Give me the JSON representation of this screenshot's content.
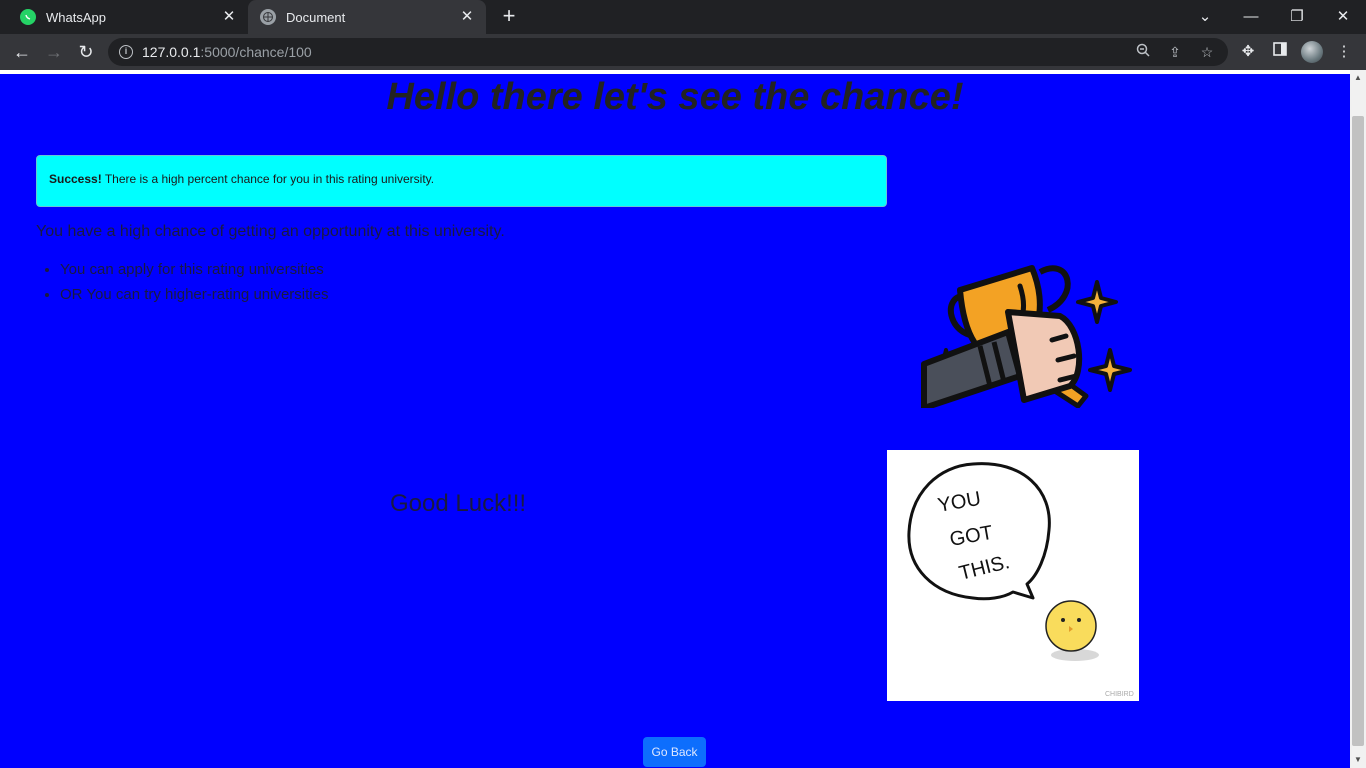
{
  "browser": {
    "tabs": [
      {
        "title": "WhatsApp",
        "icon": "whatsapp-icon",
        "active": false
      },
      {
        "title": "Document",
        "icon": "globe-icon",
        "active": true
      }
    ],
    "url_host": "127.0.0.1",
    "url_path": ":5000/chance/100",
    "accent": "#202124"
  },
  "page": {
    "background": "#0000ff",
    "heading": "Hello there let's see the chance!",
    "alert": {
      "strong": "Success!",
      "text": " There is a high percent chance for you in this rating university."
    },
    "lead": "You have a high chance of getting an opportunity at this university.",
    "bullets": [
      "You can apply for this rating universities",
      "OR You can try higher-rating universities"
    ],
    "good_luck": "Good Luck!!!",
    "motivation_image": {
      "lines": [
        "YOU",
        "GOT",
        "THIS."
      ],
      "credit": "CHIBIRD"
    },
    "go_back": "Go Back"
  }
}
